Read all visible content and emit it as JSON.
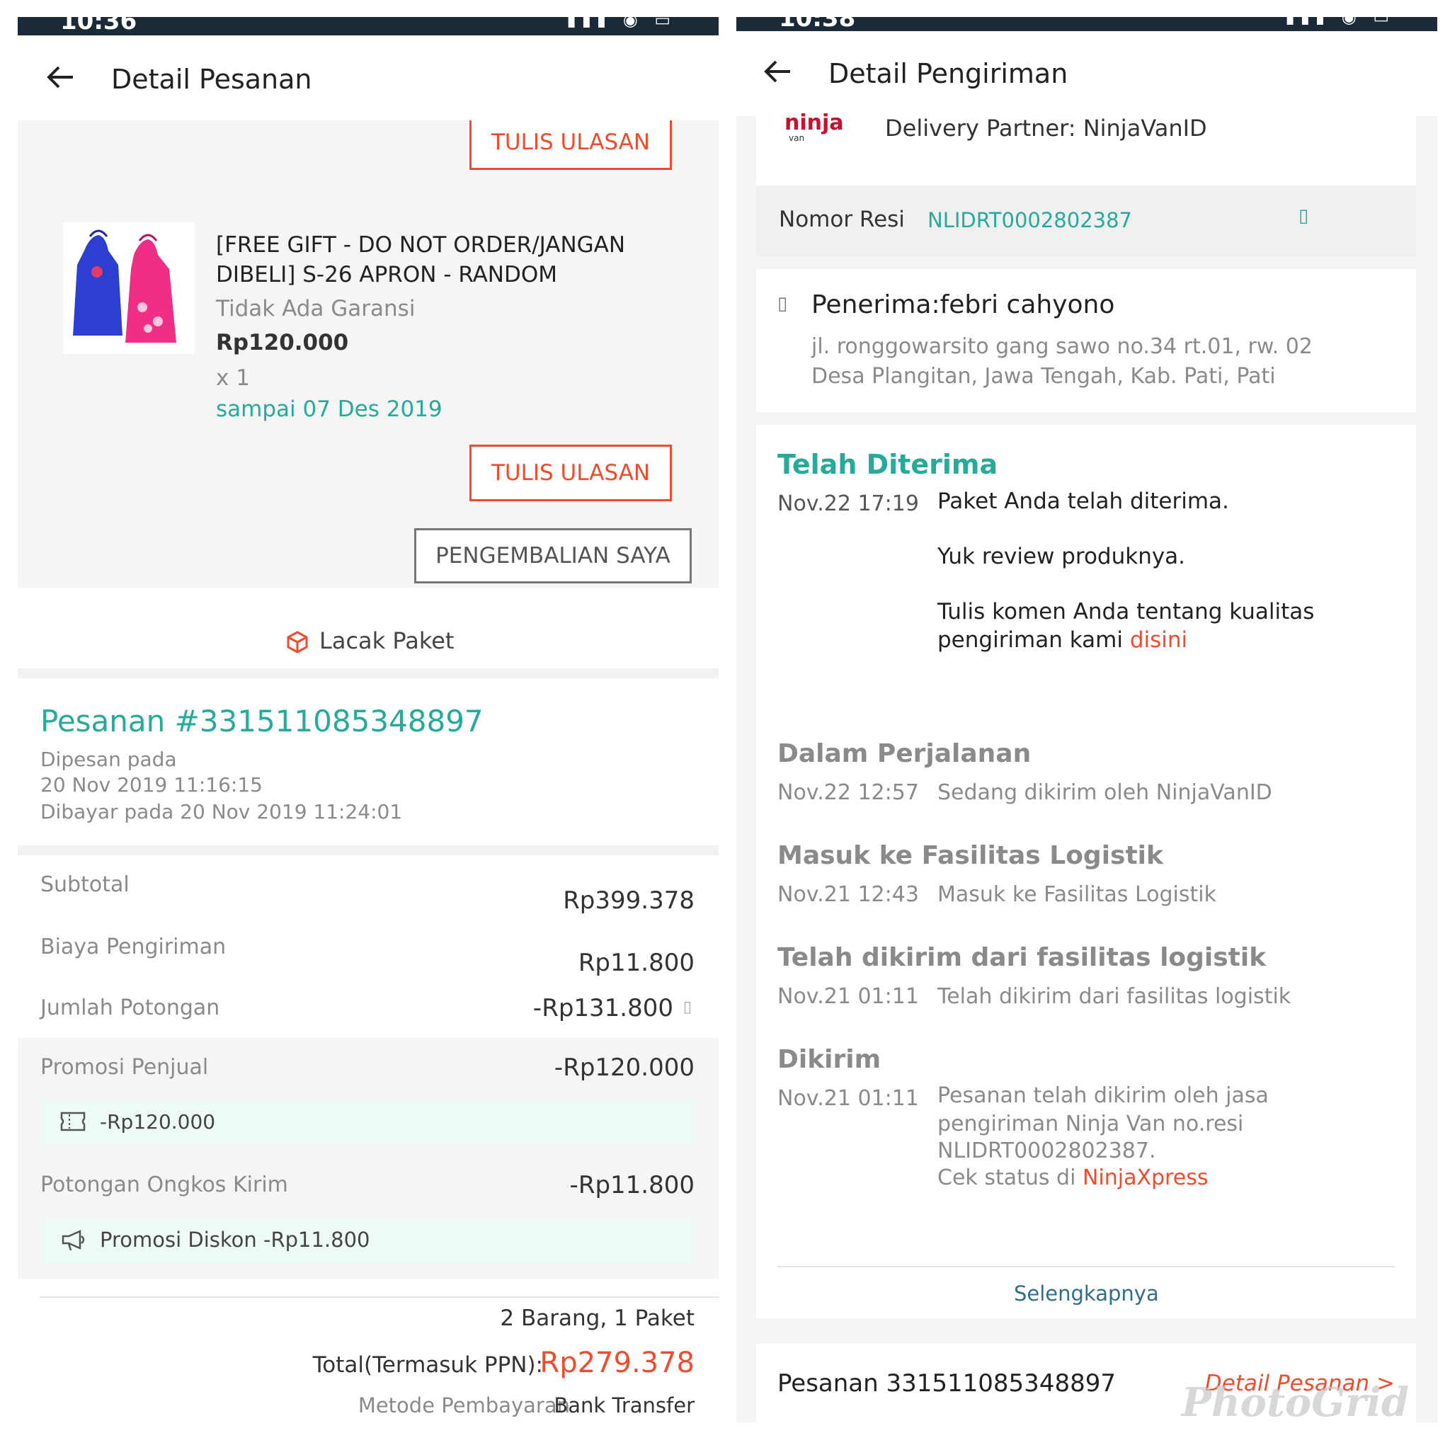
{
  "left": {
    "header_title": "Detail Pesanan",
    "review_label_top": "TULIS ULASAN",
    "product": {
      "name_line1": "[FREE GIFT - DO NOT ORDER/JANGAN",
      "name_line2": "DIBELI] S-26 APRON - RANDOM",
      "warranty": "Tidak Ada Garansi",
      "price": "Rp120.000",
      "qty": "x 1",
      "arrival": "sampai  07 Des 2019"
    },
    "review_label": "TULIS ULASAN",
    "return_label": "PENGEMBALIAN SAYA",
    "track_label": "Lacak Paket",
    "order": {
      "number": "Pesanan #331511085348897",
      "ordered_label": "Dipesan pada",
      "ordered_date": " 20 Nov 2019  11:16:15",
      "paid": "Dibayar pada 20 Nov 2019  11:24:01"
    },
    "summary": {
      "subtotal_label": "Subtotal",
      "subtotal_value": "Rp399.378",
      "shipping_label": "Biaya Pengiriman",
      "shipping_value": "Rp11.800",
      "discount_label": "Jumlah Potongan",
      "discount_value": "-Rp131.800",
      "seller_promo_label": "Promosi Penjual",
      "seller_promo_value": "-Rp120.000",
      "voucher_value": "-Rp120.000",
      "shipping_cut_label": "Potongan Ongkos Kirim",
      "shipping_cut_value": "-Rp11.800",
      "shipping_promo": "Promosi Diskon -Rp11.800",
      "items_count": "2 Barang, 1 Paket",
      "total_label": "Total(Termasuk PPN):",
      "total_value": "Rp279.378",
      "payment_label": "Metode Pembayaran",
      "payment_value": "Bank Transfer"
    }
  },
  "right": {
    "header_title": "Detail Pengiriman",
    "partner": "Delivery Partner: NinjaVanID",
    "logo_text": "ninja",
    "logo_sub": "van",
    "resi_label": "Nomor Resi",
    "resi_value": "NLIDRT0002802387",
    "receiver": "Penerima:febri cahyono",
    "address_line1": "jl. ronggowarsito gang sawo no.34 rt.01, rw. 02",
    "address_line2": "Desa Plangitan, Jawa Tengah, Kab. Pati, Pati",
    "timeline": [
      {
        "title": "Telah Diterima",
        "time": "Nov.22 17:19",
        "lines": [
          "Paket Anda telah diterima.",
          "Yuk review produknya.",
          "Tulis komen Anda tentang kualitas",
          "pengiriman kami "
        ],
        "link": "disini"
      },
      {
        "title": "Dalam Perjalanan",
        "time": "Nov.22 12:57",
        "desc": "Sedang dikirim oleh NinjaVanID"
      },
      {
        "title": "Masuk ke Fasilitas Logistik",
        "time": "Nov.21 12:43",
        "desc": "Masuk ke Fasilitas Logistik"
      },
      {
        "title": "Telah dikirim dari fasilitas logistik",
        "time": "Nov.21 01:11",
        "desc": "Telah dikirim dari fasilitas logistik"
      },
      {
        "title": "Dikirim",
        "time": "Nov.21 01:11",
        "lines": [
          "Pesanan telah dikirim oleh jasa",
          "pengiriman Ninja Van no.resi",
          "NLIDRT0002802387.",
          "Cek status di "
        ],
        "link": "NinjaXpress"
      }
    ],
    "more": "Selengkapnya",
    "order_number": "Pesanan 331511085348897",
    "order_link": "Detail Pesanan >",
    "watermark": "PhotoGrid"
  },
  "colors": {
    "accent": "#ee4d2d",
    "teal": "#26aa99",
    "statusbar": "#1b2a38"
  }
}
